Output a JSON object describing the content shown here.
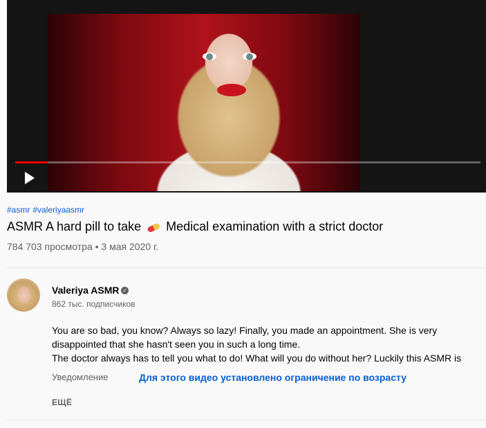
{
  "player": {
    "progress_fraction": 0.07,
    "progress_color": "#ff0000",
    "play_icon": "play-icon"
  },
  "video": {
    "hashtags": [
      "#asmr",
      "#valeriyaasmr"
    ],
    "title_before_emoji": "ASMR A hard pill to take",
    "emoji": "pill-emoji",
    "title_after_emoji": "Medical examination with a strict doctor",
    "views": "784 703 просмотра",
    "separator": "•",
    "date": "3 мая 2020 г."
  },
  "channel": {
    "name": "Valeriya ASMR",
    "verified_icon": "verified-check-icon",
    "subscribers": "862 тыс. подписчиков"
  },
  "description": {
    "lines": [
      "You are so bad, you know? Always so lazy! Finally, you made an appointment. She is very disappointed that she hasn't seen you in such a long time.",
      "The doctor always has to tell you what to do! What will you do without her? Luckily this ASMR is"
    ]
  },
  "notice": {
    "label": "Уведомление",
    "link": "Для этого видео установлено ограничение по возрасту"
  },
  "more_label": "ЕЩЁ",
  "colors": {
    "link": "#065fd4",
    "secondary_text": "#606060",
    "background": "#f9f9f9"
  }
}
